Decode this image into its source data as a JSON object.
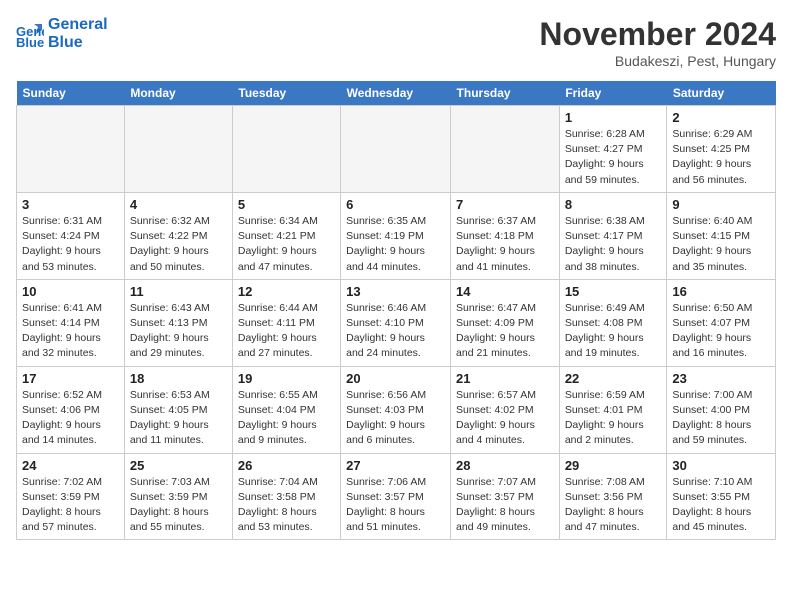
{
  "logo": {
    "line1": "General",
    "line2": "Blue"
  },
  "title": "November 2024",
  "subtitle": "Budakeszi, Pest, Hungary",
  "weekdays": [
    "Sunday",
    "Monday",
    "Tuesday",
    "Wednesday",
    "Thursday",
    "Friday",
    "Saturday"
  ],
  "weeks": [
    [
      {
        "day": "",
        "info": ""
      },
      {
        "day": "",
        "info": ""
      },
      {
        "day": "",
        "info": ""
      },
      {
        "day": "",
        "info": ""
      },
      {
        "day": "",
        "info": ""
      },
      {
        "day": "1",
        "info": "Sunrise: 6:28 AM\nSunset: 4:27 PM\nDaylight: 9 hours and 59 minutes."
      },
      {
        "day": "2",
        "info": "Sunrise: 6:29 AM\nSunset: 4:25 PM\nDaylight: 9 hours and 56 minutes."
      }
    ],
    [
      {
        "day": "3",
        "info": "Sunrise: 6:31 AM\nSunset: 4:24 PM\nDaylight: 9 hours and 53 minutes."
      },
      {
        "day": "4",
        "info": "Sunrise: 6:32 AM\nSunset: 4:22 PM\nDaylight: 9 hours and 50 minutes."
      },
      {
        "day": "5",
        "info": "Sunrise: 6:34 AM\nSunset: 4:21 PM\nDaylight: 9 hours and 47 minutes."
      },
      {
        "day": "6",
        "info": "Sunrise: 6:35 AM\nSunset: 4:19 PM\nDaylight: 9 hours and 44 minutes."
      },
      {
        "day": "7",
        "info": "Sunrise: 6:37 AM\nSunset: 4:18 PM\nDaylight: 9 hours and 41 minutes."
      },
      {
        "day": "8",
        "info": "Sunrise: 6:38 AM\nSunset: 4:17 PM\nDaylight: 9 hours and 38 minutes."
      },
      {
        "day": "9",
        "info": "Sunrise: 6:40 AM\nSunset: 4:15 PM\nDaylight: 9 hours and 35 minutes."
      }
    ],
    [
      {
        "day": "10",
        "info": "Sunrise: 6:41 AM\nSunset: 4:14 PM\nDaylight: 9 hours and 32 minutes."
      },
      {
        "day": "11",
        "info": "Sunrise: 6:43 AM\nSunset: 4:13 PM\nDaylight: 9 hours and 29 minutes."
      },
      {
        "day": "12",
        "info": "Sunrise: 6:44 AM\nSunset: 4:11 PM\nDaylight: 9 hours and 27 minutes."
      },
      {
        "day": "13",
        "info": "Sunrise: 6:46 AM\nSunset: 4:10 PM\nDaylight: 9 hours and 24 minutes."
      },
      {
        "day": "14",
        "info": "Sunrise: 6:47 AM\nSunset: 4:09 PM\nDaylight: 9 hours and 21 minutes."
      },
      {
        "day": "15",
        "info": "Sunrise: 6:49 AM\nSunset: 4:08 PM\nDaylight: 9 hours and 19 minutes."
      },
      {
        "day": "16",
        "info": "Sunrise: 6:50 AM\nSunset: 4:07 PM\nDaylight: 9 hours and 16 minutes."
      }
    ],
    [
      {
        "day": "17",
        "info": "Sunrise: 6:52 AM\nSunset: 4:06 PM\nDaylight: 9 hours and 14 minutes."
      },
      {
        "day": "18",
        "info": "Sunrise: 6:53 AM\nSunset: 4:05 PM\nDaylight: 9 hours and 11 minutes."
      },
      {
        "day": "19",
        "info": "Sunrise: 6:55 AM\nSunset: 4:04 PM\nDaylight: 9 hours and 9 minutes."
      },
      {
        "day": "20",
        "info": "Sunrise: 6:56 AM\nSunset: 4:03 PM\nDaylight: 9 hours and 6 minutes."
      },
      {
        "day": "21",
        "info": "Sunrise: 6:57 AM\nSunset: 4:02 PM\nDaylight: 9 hours and 4 minutes."
      },
      {
        "day": "22",
        "info": "Sunrise: 6:59 AM\nSunset: 4:01 PM\nDaylight: 9 hours and 2 minutes."
      },
      {
        "day": "23",
        "info": "Sunrise: 7:00 AM\nSunset: 4:00 PM\nDaylight: 8 hours and 59 minutes."
      }
    ],
    [
      {
        "day": "24",
        "info": "Sunrise: 7:02 AM\nSunset: 3:59 PM\nDaylight: 8 hours and 57 minutes."
      },
      {
        "day": "25",
        "info": "Sunrise: 7:03 AM\nSunset: 3:59 PM\nDaylight: 8 hours and 55 minutes."
      },
      {
        "day": "26",
        "info": "Sunrise: 7:04 AM\nSunset: 3:58 PM\nDaylight: 8 hours and 53 minutes."
      },
      {
        "day": "27",
        "info": "Sunrise: 7:06 AM\nSunset: 3:57 PM\nDaylight: 8 hours and 51 minutes."
      },
      {
        "day": "28",
        "info": "Sunrise: 7:07 AM\nSunset: 3:57 PM\nDaylight: 8 hours and 49 minutes."
      },
      {
        "day": "29",
        "info": "Sunrise: 7:08 AM\nSunset: 3:56 PM\nDaylight: 8 hours and 47 minutes."
      },
      {
        "day": "30",
        "info": "Sunrise: 7:10 AM\nSunset: 3:55 PM\nDaylight: 8 hours and 45 minutes."
      }
    ]
  ]
}
